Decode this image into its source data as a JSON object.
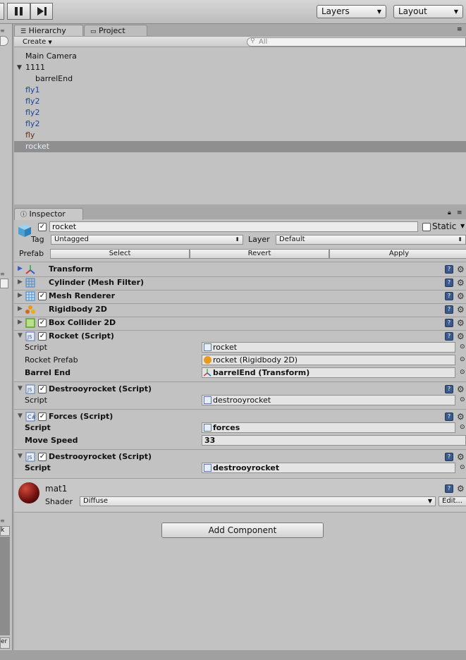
{
  "toolbar": {
    "pause_icon": "pause-icon",
    "step_icon": "step-icon",
    "layers_label": "Layers",
    "layout_label": "Layout"
  },
  "hierarchy": {
    "tab_label": "Hierarchy",
    "project_tab_label": "Project",
    "create_label": "Create",
    "search_placeholder": "All",
    "items": [
      {
        "label": "Main Camera",
        "color": "#111111"
      },
      {
        "label": "1111",
        "color": "#111111"
      },
      {
        "label": "barrelEnd",
        "color": "#111111"
      },
      {
        "label": "fly1",
        "color": "#1f3fa0"
      },
      {
        "label": "fly2",
        "color": "#1f3fa0"
      },
      {
        "label": "fly2",
        "color": "#1f3fa0"
      },
      {
        "label": "fly2",
        "color": "#1f3fa0"
      },
      {
        "label": "fly",
        "color": "#6b2b1b"
      },
      {
        "label": "rocket",
        "color": "#e7ecf8"
      }
    ]
  },
  "inspector": {
    "tab_label": "Inspector",
    "object_name": "rocket",
    "static_label": "Static",
    "tag_label": "Tag",
    "tag_value": "Untagged",
    "layer_label": "Layer",
    "layer_value": "Default",
    "prefab_label": "Prefab",
    "prefab_select": "Select",
    "prefab_revert": "Revert",
    "prefab_apply": "Apply",
    "components": [
      {
        "title": "Transform"
      },
      {
        "title": "Cylinder (Mesh Filter)"
      },
      {
        "title": "Mesh Renderer"
      },
      {
        "title": "Rigidbody 2D"
      },
      {
        "title": "Box Collider 2D"
      },
      {
        "title": "Rocket (Script)"
      },
      {
        "title": "Destrooyrocket (Script)"
      },
      {
        "title": "Forces (Script)"
      },
      {
        "title": "Destrooyrocket (Script)"
      }
    ],
    "rocket_fields": [
      {
        "label": "Script",
        "value": "rocket"
      },
      {
        "label": "Rocket Prefab",
        "value": "rocket (Rigidbody 2D)"
      },
      {
        "label": "Barrel End",
        "value": "barrelEnd (Transform)"
      }
    ],
    "destroy1_fields": [
      {
        "label": "Script",
        "value": "destrooyrocket"
      }
    ],
    "forces_fields": [
      {
        "label": "Script",
        "value": "forces"
      },
      {
        "label": "Move Speed",
        "value": "33"
      }
    ],
    "destroy2_fields": [
      {
        "label": "Script",
        "value": "destrooyrocket"
      }
    ],
    "material": {
      "name": "mat1",
      "shader_label": "Shader",
      "shader_value": "Diffuse",
      "edit_label": "Edit..."
    },
    "add_component_label": "Add Component"
  }
}
